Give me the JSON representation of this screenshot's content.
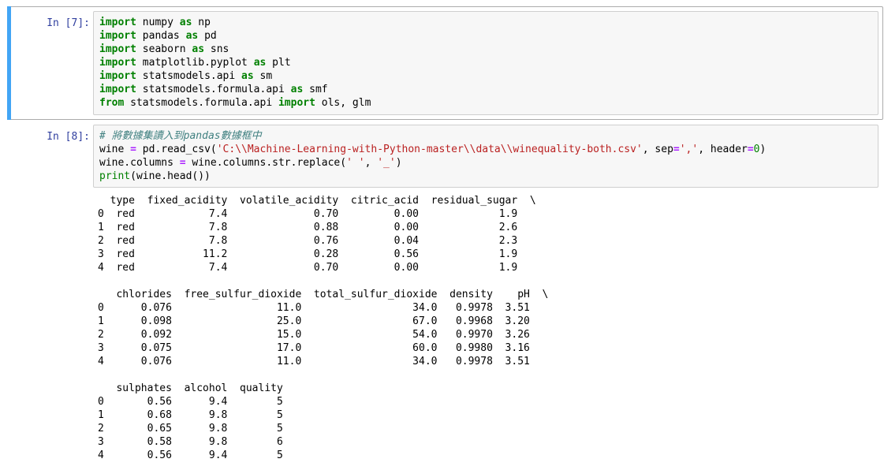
{
  "cells": [
    {
      "prompt": "In [7]:",
      "lines": [
        [
          "import",
          "numpy",
          "as",
          "np"
        ],
        [
          "import",
          "pandas",
          "as",
          "pd"
        ],
        [
          "import",
          "seaborn",
          "as",
          "sns"
        ],
        [
          "import",
          "matplotlib.pyplot",
          "as",
          "plt"
        ],
        [
          "import",
          "statsmodels.api",
          "as",
          "sm"
        ],
        [
          "import",
          "statsmodels.formula.api",
          "as",
          "smf"
        ],
        [
          "from",
          "statsmodels.formula.api",
          "import",
          "ols, glm"
        ]
      ]
    },
    {
      "prompt": "In [8]:",
      "comment": "# 將數據集讀入到pandas數據框中",
      "line2": {
        "lhs": "wine",
        "call": "pd.read_csv(",
        "path": "'C:\\\\Machine-Learning-with-Python-master\\\\data\\\\winequality-both.csv'",
        "sep_kw": ", sep",
        "sep_val": "','",
        "hdr_kw": ", header",
        "hdr_val": "0",
        "close": ")"
      },
      "line3": {
        "lhs": "wine.columns",
        "rhs": "wine.columns.str.replace(",
        "a": "' '",
        "comma": ", ",
        "b": "'_'",
        "close": ")"
      },
      "line4": {
        "fn": "print",
        "arg": "(wine.head())"
      },
      "output": [
        "  type  fixed_acidity  volatile_acidity  citric_acid  residual_sugar  \\",
        "0  red            7.4              0.70         0.00             1.9",
        "1  red            7.8              0.88         0.00             2.6",
        "2  red            7.8              0.76         0.04             2.3",
        "3  red           11.2              0.28         0.56             1.9",
        "4  red            7.4              0.70         0.00             1.9",
        "",
        "   chlorides  free_sulfur_dioxide  total_sulfur_dioxide  density    pH  \\",
        "0      0.076                 11.0                  34.0   0.9978  3.51",
        "1      0.098                 25.0                  67.0   0.9968  3.20",
        "2      0.092                 15.0                  54.0   0.9970  3.26",
        "3      0.075                 17.0                  60.0   0.9980  3.16",
        "4      0.076                 11.0                  34.0   0.9978  3.51",
        "",
        "   sulphates  alcohol  quality",
        "0       0.56      9.4        5",
        "1       0.68      9.8        5",
        "2       0.65      9.8        5",
        "3       0.58      9.8        6",
        "4       0.56      9.4        5"
      ]
    }
  ],
  "colors": {
    "selection": "#42a5f5",
    "prompt": "#303f9f",
    "keyword": "#008000",
    "string": "#ba2121",
    "comment": "#408080"
  }
}
